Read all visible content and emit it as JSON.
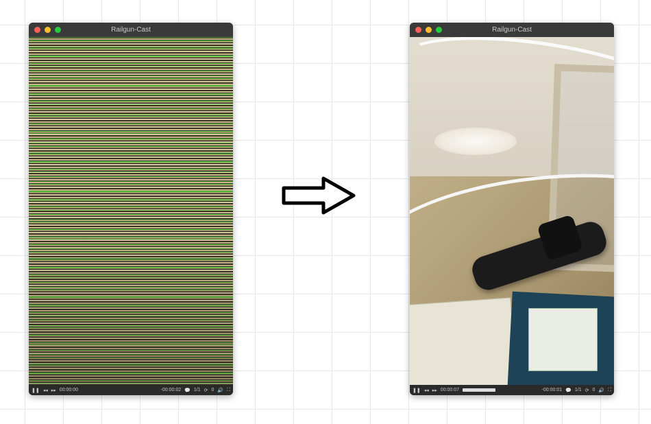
{
  "left_window": {
    "title": "Railgun-Cast",
    "controls": {
      "pause_icon": "❚❚",
      "prev_icon": "◂◂",
      "next_icon": "▸▸",
      "elapsed": "00:00:00",
      "remaining": "-00:00:02",
      "chat_icon": "💬",
      "chapter": "1/1",
      "loop_icon": "⟳",
      "subtitle_icon": "0",
      "volume_icon": "🔊",
      "fullscreen_icon": "⛶"
    }
  },
  "right_window": {
    "title": "Railgun-Cast",
    "controls": {
      "pause_icon": "❚❚",
      "prev_icon": "◂◂",
      "next_icon": "▸▸",
      "elapsed": "00:00:07",
      "remaining": "-00:00:01",
      "chat_icon": "💬",
      "chapter": "1/1",
      "loop_icon": "⟳",
      "subtitle_icon": "0",
      "volume_icon": "🔊",
      "fullscreen_icon": "⛶"
    }
  }
}
